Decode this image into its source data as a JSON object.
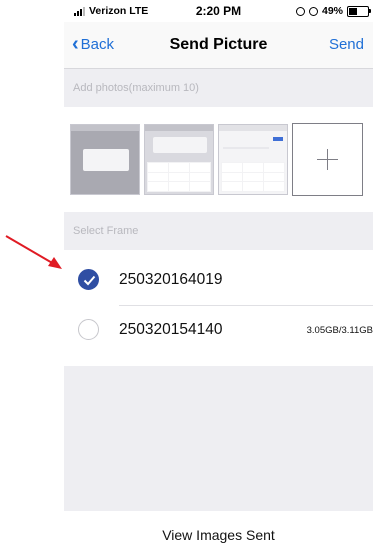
{
  "status_bar": {
    "carrier": "Verizon LTE",
    "time": "2:20 PM",
    "battery_percent": "49%",
    "battery_level": 0.49
  },
  "nav": {
    "back_label": "Back",
    "title": "Send Picture",
    "send_label": "Send"
  },
  "photos": {
    "header": "Add photos(maximum 10)",
    "thumbnail_count": 3
  },
  "frames": {
    "header": "Select Frame",
    "items": [
      {
        "name": "250320164019",
        "selected": true,
        "storage": ""
      },
      {
        "name": "250320154140",
        "selected": false,
        "storage": "3.05GB/3.11GB"
      }
    ]
  },
  "footer": {
    "view_sent_label": "View Images Sent"
  },
  "colors": {
    "accent_blue": "#1f6fd6",
    "selected_radio": "#2f4ea3",
    "annotation_arrow": "#e01b24",
    "section_bg": "#eeeef2"
  }
}
